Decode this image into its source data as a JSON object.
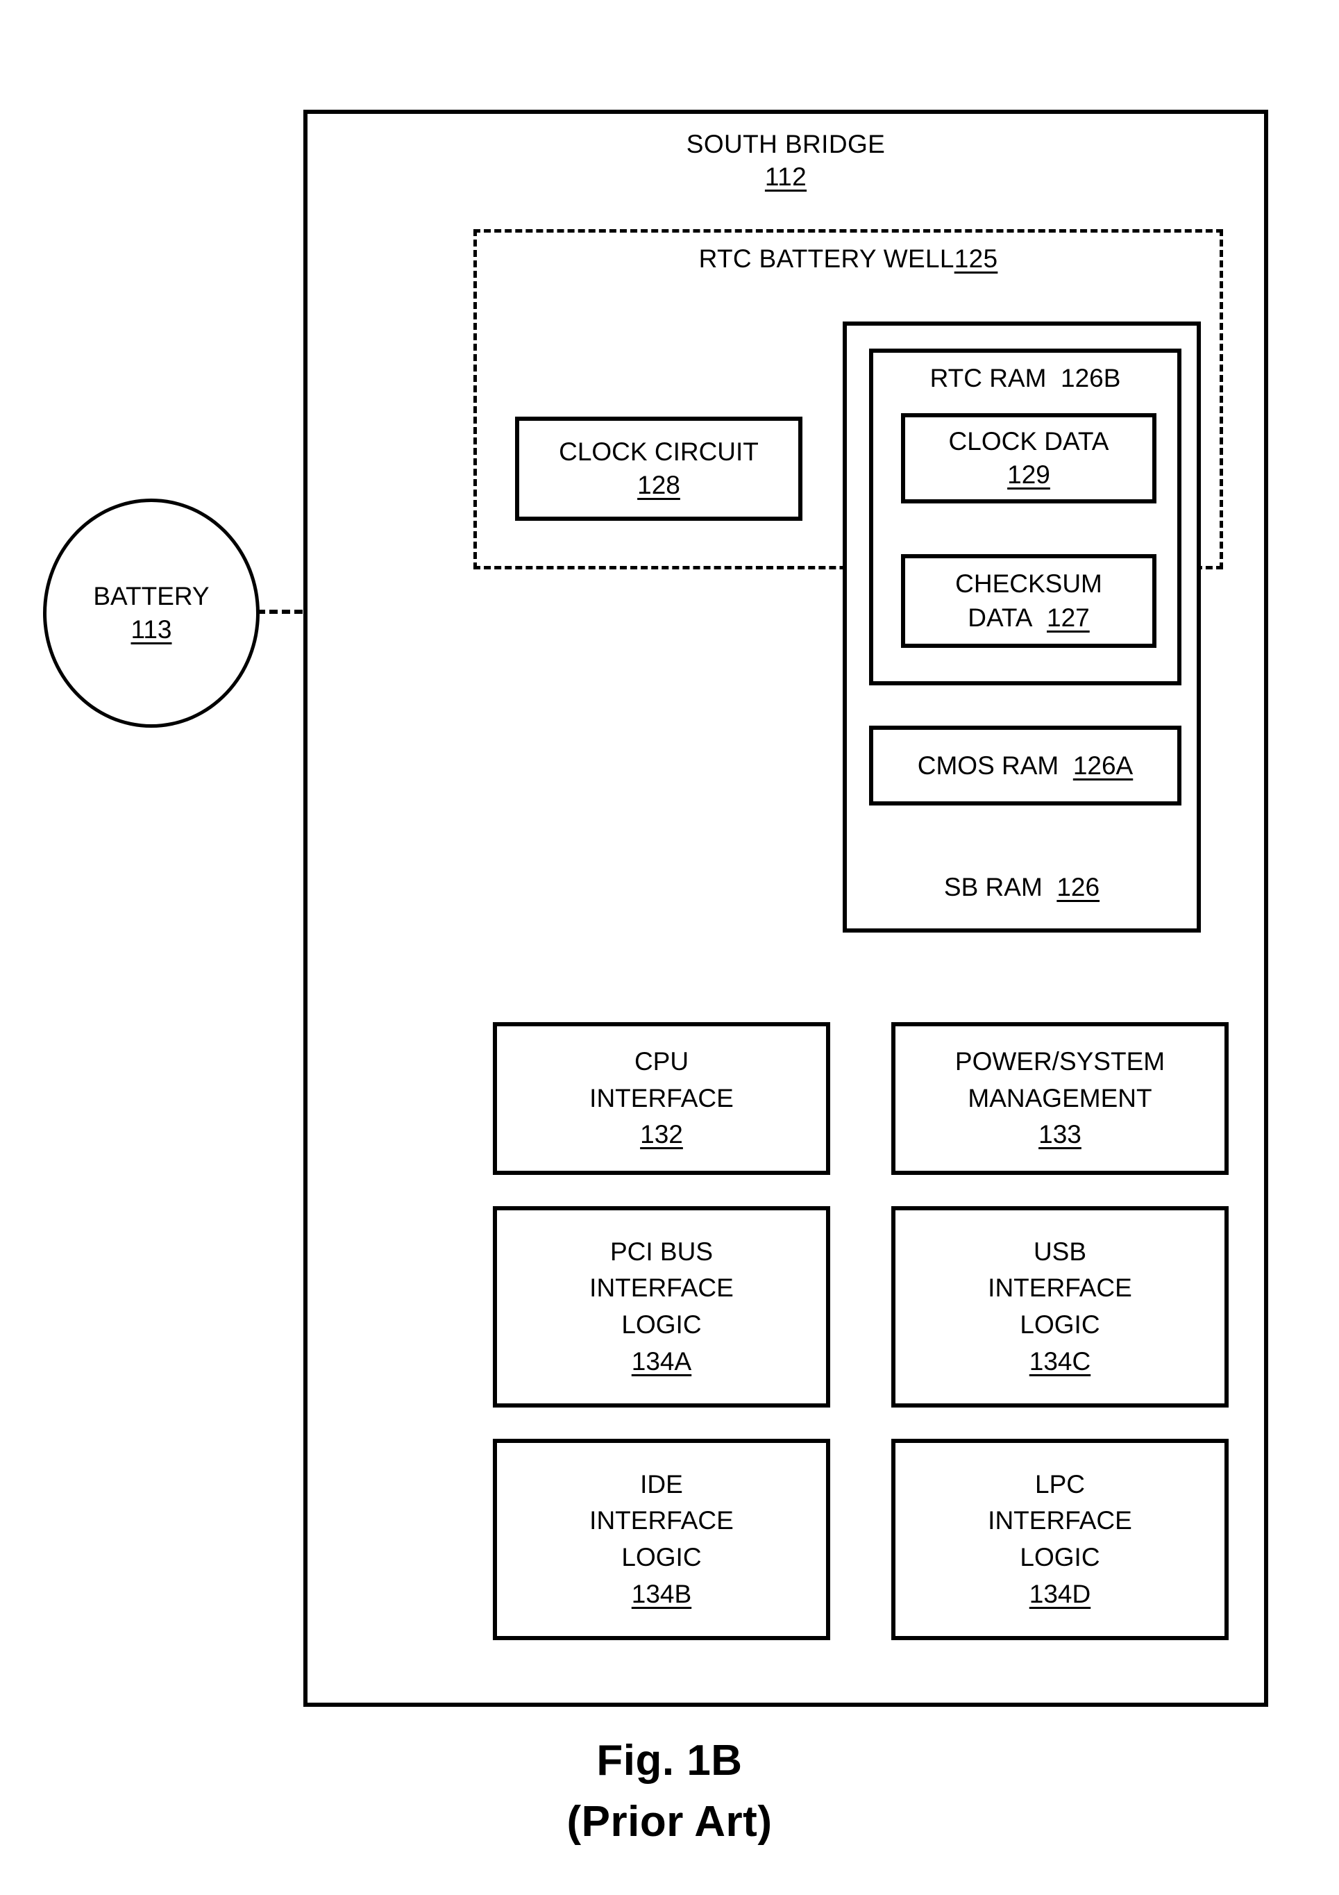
{
  "figure": {
    "caption_line1": "Fig. 1B",
    "caption_line2": "(Prior Art)"
  },
  "south_bridge": {
    "title": "SOUTH BRIDGE",
    "ref": "112"
  },
  "battery": {
    "label": "BATTERY",
    "ref": "113",
    "connector": "dashed-power-line"
  },
  "rtc_battery_well": {
    "label": "RTC BATTERY WELL",
    "ref": "125"
  },
  "clock_circuit": {
    "label": "CLOCK CIRCUIT",
    "ref": "128"
  },
  "sb_ram": {
    "label": "SB RAM",
    "ref": "126",
    "rtc_ram": {
      "label": "RTC RAM",
      "ref": "126B",
      "clock_data": {
        "label": "CLOCK DATA",
        "ref": "129"
      },
      "checksum_data": {
        "label_line1": "CHECKSUM",
        "label_line2": "DATA",
        "ref": "127"
      }
    },
    "cmos_ram": {
      "label": "CMOS RAM",
      "ref": "126A"
    }
  },
  "interfaces": [
    {
      "name": "cpu-interface",
      "line1": "CPU",
      "line2": "INTERFACE",
      "line3": "",
      "ref": "132"
    },
    {
      "name": "power-system-management",
      "line1": "POWER/SYSTEM",
      "line2": "MANAGEMENT",
      "line3": "",
      "ref": "133"
    },
    {
      "name": "pci-bus-interface-logic",
      "line1": "PCI BUS",
      "line2": "INTERFACE",
      "line3": "LOGIC",
      "ref": "134A"
    },
    {
      "name": "usb-interface-logic",
      "line1": "USB",
      "line2": "INTERFACE",
      "line3": "LOGIC",
      "ref": "134C"
    },
    {
      "name": "ide-interface-logic",
      "line1": "IDE",
      "line2": "INTERFACE",
      "line3": "LOGIC",
      "ref": "134B"
    },
    {
      "name": "lpc-interface-logic",
      "line1": "LPC",
      "line2": "INTERFACE",
      "line3": "LOGIC",
      "ref": "134D"
    }
  ],
  "colors": {
    "ink": "#000000",
    "paper": "#ffffff"
  }
}
